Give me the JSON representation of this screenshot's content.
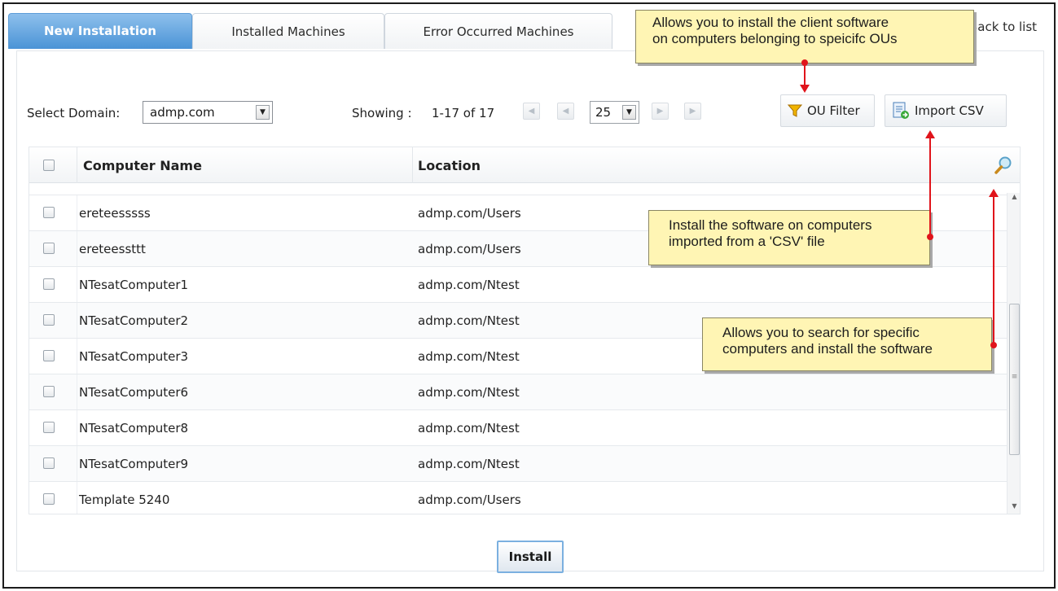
{
  "tabs": [
    {
      "label": "New Installation",
      "active": true
    },
    {
      "label": "Installed Machines",
      "active": false
    },
    {
      "label": "Error Occurred Machines",
      "active": false
    }
  ],
  "back_link": "Back to list",
  "toolbar": {
    "domain_label": "Select Domain:",
    "domain_value": "admp.com",
    "showing_label": "Showing :",
    "showing_range": "1-17 of 17",
    "page_size": "25",
    "ou_filter_label": "OU Filter",
    "import_csv_label": "Import CSV"
  },
  "table": {
    "columns": [
      "Computer Name",
      "Location"
    ],
    "rows": [
      {
        "name": "ereteesssss",
        "location": "admp.com/Users"
      },
      {
        "name": "ereteessttt",
        "location": "admp.com/Users"
      },
      {
        "name": "NTesatComputer1",
        "location": "admp.com/Ntest"
      },
      {
        "name": "NTesatComputer2",
        "location": "admp.com/Ntest"
      },
      {
        "name": "NTesatComputer3",
        "location": "admp.com/Ntest"
      },
      {
        "name": "NTesatComputer6",
        "location": "admp.com/Ntest"
      },
      {
        "name": "NTesatComputer8",
        "location": "admp.com/Ntest"
      },
      {
        "name": "NTesatComputer9",
        "location": "admp.com/Ntest"
      },
      {
        "name": "Template 5240",
        "location": "admp.com/Users"
      }
    ]
  },
  "install_label": "Install",
  "callouts": {
    "ou_filter": [
      "Allows you to install the client software",
      "on computers belonging to speicifc OUs"
    ],
    "import_csv": [
      "Install the software on computers",
      "imported from a 'CSV' file"
    ],
    "search": [
      "Allows you to search for specific",
      "computers and install the software"
    ]
  },
  "colors": {
    "active_tab": "#4a93d6",
    "callout_bg": "#fff5b4",
    "annotation_arrow": "#e0141b"
  },
  "icons": {
    "ou_filter": "funnel-icon",
    "import_csv": "csv-import-icon",
    "search": "magnifier-icon"
  }
}
